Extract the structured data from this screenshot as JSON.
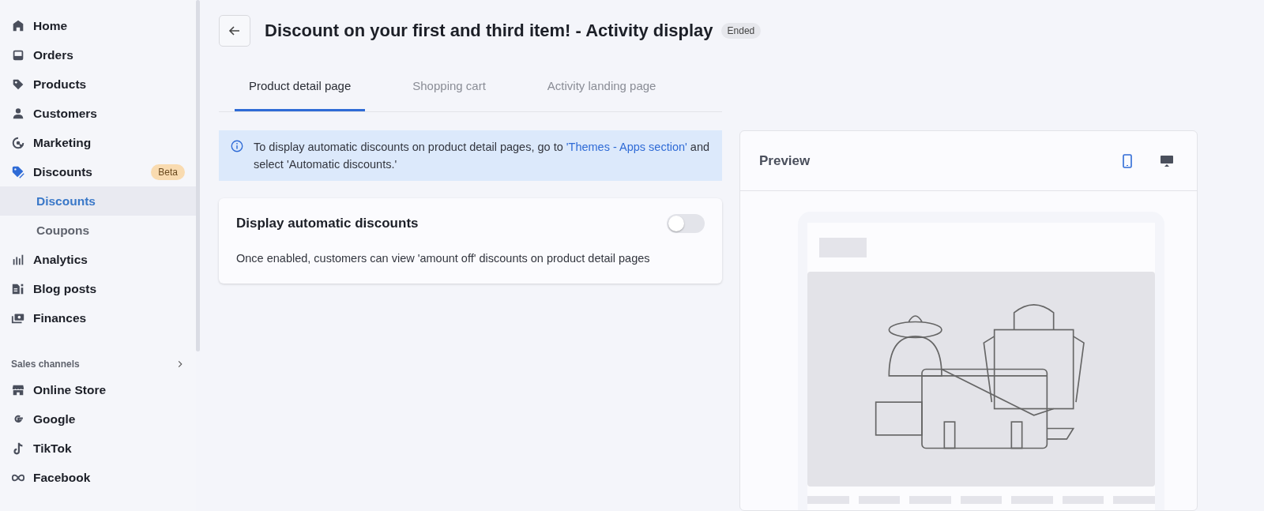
{
  "sidebar": {
    "items": [
      {
        "label": "Home"
      },
      {
        "label": "Orders"
      },
      {
        "label": "Products"
      },
      {
        "label": "Customers"
      },
      {
        "label": "Marketing"
      },
      {
        "label": "Discounts",
        "badge": "Beta",
        "children": [
          {
            "label": "Discounts",
            "selected": true
          },
          {
            "label": "Coupons",
            "selected": false
          }
        ]
      },
      {
        "label": "Analytics"
      },
      {
        "label": "Blog posts"
      },
      {
        "label": "Finances"
      }
    ],
    "sales_channels": {
      "title": "Sales channels",
      "items": [
        {
          "label": "Online Store"
        },
        {
          "label": "Google"
        },
        {
          "label": "TikTok"
        },
        {
          "label": "Facebook"
        }
      ]
    }
  },
  "header": {
    "title": "Discount on your first and third item! - Activity display",
    "status": "Ended"
  },
  "tabs": [
    {
      "label": "Product detail page",
      "selected": true
    },
    {
      "label": "Shopping cart",
      "selected": false
    },
    {
      "label": "Activity landing page",
      "selected": false
    }
  ],
  "info_banner": {
    "text_before": "To display automatic discounts on product detail pages, go to ",
    "link": "'Themes - Apps section'",
    "text_after": " and select 'Automatic discounts.'"
  },
  "setting_card": {
    "title": "Display automatic discounts",
    "on": false,
    "description": "Once enabled, customers can view 'amount off' discounts on product detail pages"
  },
  "preview": {
    "title": "Preview",
    "devices": [
      {
        "kind": "mobile",
        "selected": true
      },
      {
        "kind": "desktop",
        "selected": false
      }
    ]
  }
}
